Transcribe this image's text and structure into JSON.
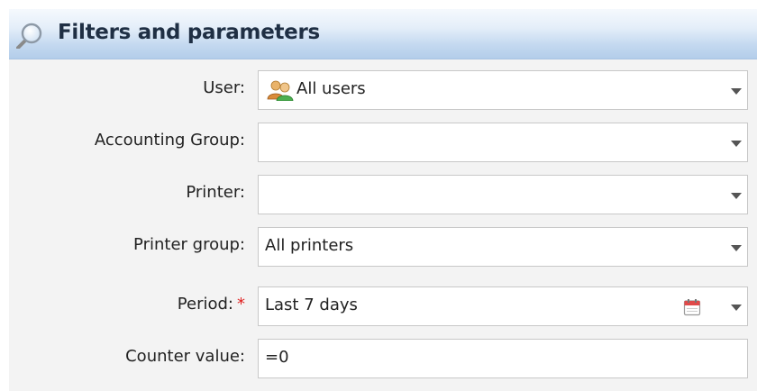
{
  "panel": {
    "title": "Filters and parameters",
    "header_icon": "magnifier-icon"
  },
  "fields": {
    "user": {
      "label": "User:",
      "value": "All users",
      "icon": "users-icon"
    },
    "accounting_group": {
      "label": "Accounting Group:",
      "value": ""
    },
    "printer": {
      "label": "Printer:",
      "value": ""
    },
    "printer_group": {
      "label": "Printer group:",
      "value": "All printers"
    },
    "period": {
      "label": "Period:",
      "required_mark": "*",
      "value": "Last 7 days",
      "icon": "calendar-icon"
    },
    "counter_value": {
      "label": "Counter value:",
      "value": "=0"
    }
  },
  "colors": {
    "header_gradient_top": "#f5f9fd",
    "header_gradient_bottom": "#b3cdea",
    "panel_background": "#f3f3f3",
    "required": "#e02020"
  }
}
